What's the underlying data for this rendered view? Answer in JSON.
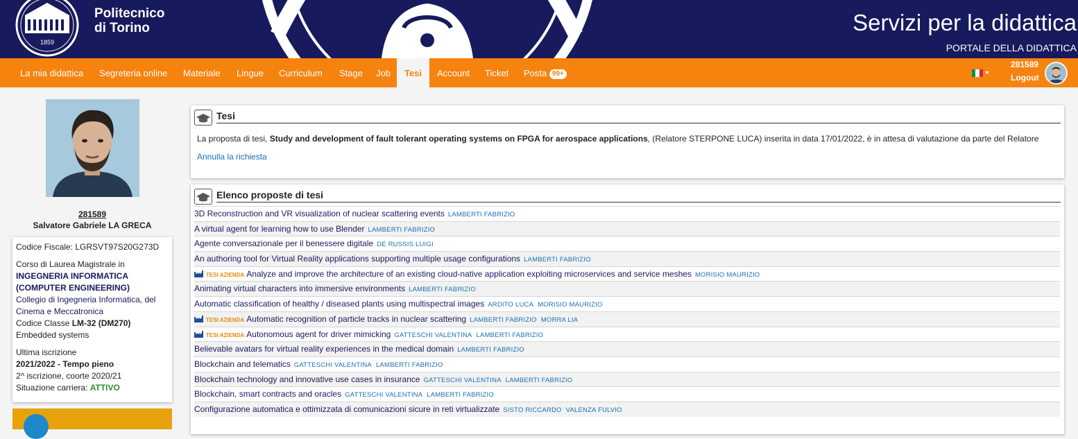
{
  "header": {
    "logo_line1": "Politecnico",
    "logo_line2": "di Torino",
    "crest_year": "1859",
    "site_title": "Servizi per la didattica",
    "site_subtitle": "PORTALE DELLA DIDATTICA"
  },
  "nav": {
    "items": [
      {
        "label": "La mia didattica"
      },
      {
        "label": "Segreteria online"
      },
      {
        "label": "Materiale"
      },
      {
        "label": "Lingue"
      },
      {
        "label": "Curriculum"
      },
      {
        "label": "Stage"
      },
      {
        "label": "Job"
      },
      {
        "label": "Tesi",
        "active": true
      },
      {
        "label": "Account"
      },
      {
        "label": "Ticket"
      },
      {
        "label": "Posta"
      }
    ],
    "mail_badge": "99+",
    "language_flag": "italy-flag-icon",
    "user_id": "281589",
    "logout_label": "Logout",
    "colors": {
      "bar": "#f7830f",
      "header": "#171a5c"
    }
  },
  "student": {
    "id": "281589",
    "name": "Salvatore Gabriele LA GRECA",
    "codice_fiscale_label": "Codice Fiscale:",
    "codice_fiscale": "LGRSVT97S20G273D",
    "course_label": "Corso di Laurea Magistrale in",
    "course_name_1": "INGEGNERIA INFORMATICA",
    "course_name_2": "(COMPUTER ENGINEERING)",
    "college": "Collegio di Ingegneria Informatica, del Cinema e Meccatronica",
    "class_label": "Codice Classe",
    "class_code": "LM-32 (DM270)",
    "track": "Embedded systems",
    "last_enrollment_label": "Ultima iscrizione",
    "last_enrollment": "2021/2022 - Tempo pieno",
    "enrollment_detail": "2^ iscrizione, coorte 2020/21",
    "career_label": "Situazione carriera:",
    "career_status": "ATTIVO"
  },
  "tesi_panel": {
    "title": "Tesi",
    "msg_prefix": "La proposta di tesi,",
    "thesis_title": "Study and development of fault tolerant operating systems on FPGA for aerospace applications",
    "msg_suffix": ", (Relatore STERPONE LUCA) inserita in data 17/01/2022, è in attesa di valutazione da parte del Relatore",
    "cancel_label": "Annulla la richiesta"
  },
  "proposals_panel": {
    "title": "Elenco proposte di tesi",
    "azienda_label": "TESI AZIENDA",
    "rows": [
      {
        "title": "3D Reconstruction and VR visualization of nuclear scattering events",
        "supervisors": [
          "LAMBERTI FABRIZIO"
        ],
        "azienda": false
      },
      {
        "title": "A virtual agent for learning how to use Blender",
        "supervisors": [
          "LAMBERTI FABRIZIO"
        ],
        "azienda": false
      },
      {
        "title": "Agente conversazionale per il benessere digitale",
        "supervisors": [
          "DE RUSSIS LUIGI"
        ],
        "azienda": false
      },
      {
        "title": "An authoring tool for Virtual Reality applications supporting multiple usage configurations",
        "supervisors": [
          "LAMBERTI FABRIZIO"
        ],
        "azienda": false
      },
      {
        "title": "Analyze and improve the architecture of an existing cloud-native application exploiting microservices and service meshes",
        "supervisors": [
          "MORISIO MAURIZIO"
        ],
        "azienda": true
      },
      {
        "title": "Animating virtual characters into immersive environments",
        "supervisors": [
          "LAMBERTI FABRIZIO"
        ],
        "azienda": false
      },
      {
        "title": "Automatic classification of healthy / diseased plants using multispectral images",
        "supervisors": [
          "ARDITO LUCA",
          "MORISIO MAURIZIO"
        ],
        "azienda": false
      },
      {
        "title": "Automatic recognition of particle tracks in nuclear scattering",
        "supervisors": [
          "LAMBERTI FABRIZIO",
          "MORRA LIA"
        ],
        "azienda": true
      },
      {
        "title": "Autonomous agent for driver mimicking",
        "supervisors": [
          "GATTESCHI VALENTINA",
          "LAMBERTI FABRIZIO"
        ],
        "azienda": true
      },
      {
        "title": "Believable avatars for virtual reality experiences in the medical domain",
        "supervisors": [
          "LAMBERTI FABRIZIO"
        ],
        "azienda": false
      },
      {
        "title": "Blockchain and telematics",
        "supervisors": [
          "GATTESCHI VALENTINA",
          "LAMBERTI FABRIZIO"
        ],
        "azienda": false
      },
      {
        "title": "Blockchain technology and innovative use cases in insurance",
        "supervisors": [
          "GATTESCHI VALENTINA",
          "LAMBERTI FABRIZIO"
        ],
        "azienda": false
      },
      {
        "title": "Blockchain, smart contracts and oracles",
        "supervisors": [
          "GATTESCHI VALENTINA",
          "LAMBERTI FABRIZIO"
        ],
        "azienda": false
      },
      {
        "title": "Configurazione automatica e ottimizzata di comunicazioni sicure in reti virtualizzate",
        "supervisors": [
          "SISTO RICCARDO",
          "VALENZA FULVIO"
        ],
        "azienda": false
      }
    ]
  }
}
